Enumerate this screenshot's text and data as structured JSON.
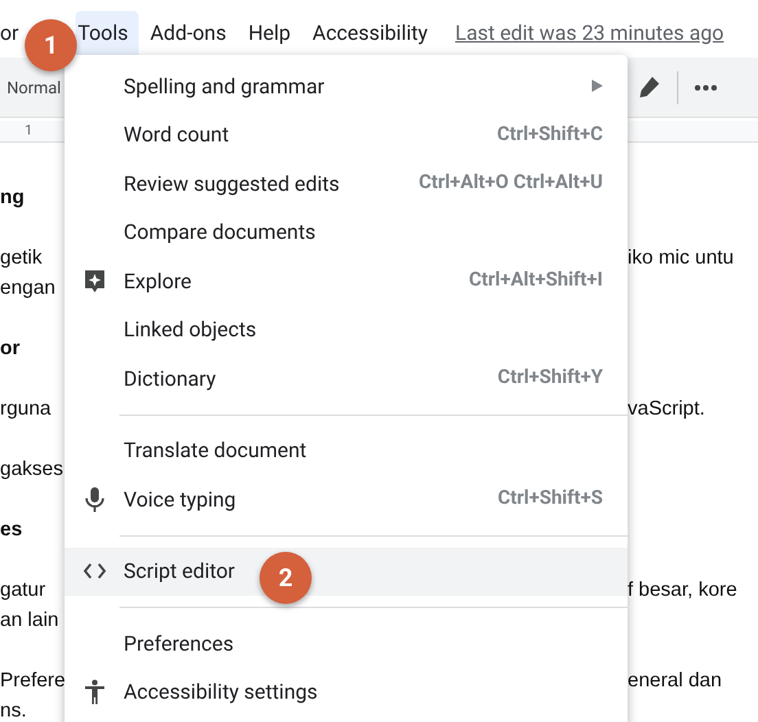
{
  "menubar": {
    "items": [
      {
        "label": "or",
        "selected": false
      },
      {
        "label": "Tools",
        "selected": true
      },
      {
        "label": "Add-ons",
        "selected": false
      },
      {
        "label": "Help",
        "selected": false
      },
      {
        "label": "Accessibility",
        "selected": false
      }
    ],
    "last_edit": "Last edit was 23 minutes ago"
  },
  "toolbar": {
    "style": "Normal"
  },
  "ruler": {
    "mark": "1"
  },
  "document": {
    "paragraphs": [
      {
        "bold": true,
        "lines": [
          {
            "left": "ng"
          }
        ]
      },
      {
        "bold": false,
        "lines": [
          {
            "left": "getik",
            "right": "iko mic untu"
          },
          {
            "left": "engan"
          }
        ]
      },
      {
        "bold": true,
        "lines": [
          {
            "left": "or"
          }
        ]
      },
      {
        "bold": false,
        "lines": [
          {
            "left": "rguna",
            "right": "vaScript."
          }
        ]
      },
      {
        "bold": false,
        "lines": [
          {
            "left": "gakses"
          }
        ]
      },
      {
        "bold": true,
        "lines": [
          {
            "left": "es"
          }
        ]
      },
      {
        "bold": false,
        "lines": [
          {
            "left": "gatur",
            "right": "f besar, kore"
          },
          {
            "left": "an lain"
          }
        ]
      },
      {
        "bold": false,
        "lines": [
          {
            "left": "Prefere",
            "right": "eneral dan"
          },
          {
            "left": "ns."
          }
        ]
      }
    ]
  },
  "menu": {
    "items": [
      {
        "kind": "item",
        "label": "Spelling and grammar",
        "submenu": true,
        "selected": false
      },
      {
        "kind": "item",
        "label": "Word count",
        "shortcut": "Ctrl+Shift+C",
        "selected": false
      },
      {
        "kind": "item",
        "label": "Review suggested edits",
        "shortcut": "Ctrl+Alt+O Ctrl+Alt+U",
        "selected": false
      },
      {
        "kind": "item",
        "label": "Compare documents",
        "selected": false
      },
      {
        "kind": "item",
        "label": "Explore",
        "shortcut": "Ctrl+Alt+Shift+I",
        "selected": false
      },
      {
        "kind": "item",
        "label": "Linked objects",
        "selected": false
      },
      {
        "kind": "item",
        "label": "Dictionary",
        "shortcut": "Ctrl+Shift+Y",
        "selected": false
      },
      {
        "kind": "divider"
      },
      {
        "kind": "item",
        "label": "Translate document",
        "selected": false
      },
      {
        "kind": "item",
        "label": "Voice typing",
        "shortcut": "Ctrl+Shift+S",
        "selected": false
      },
      {
        "kind": "divider"
      },
      {
        "kind": "item",
        "label": "Script editor",
        "selected": true
      },
      {
        "kind": "divider"
      },
      {
        "kind": "item",
        "label": "Preferences",
        "selected": false
      },
      {
        "kind": "item",
        "label": "Accessibility settings",
        "selected": false
      }
    ]
  },
  "callouts": [
    "1",
    "2"
  ]
}
